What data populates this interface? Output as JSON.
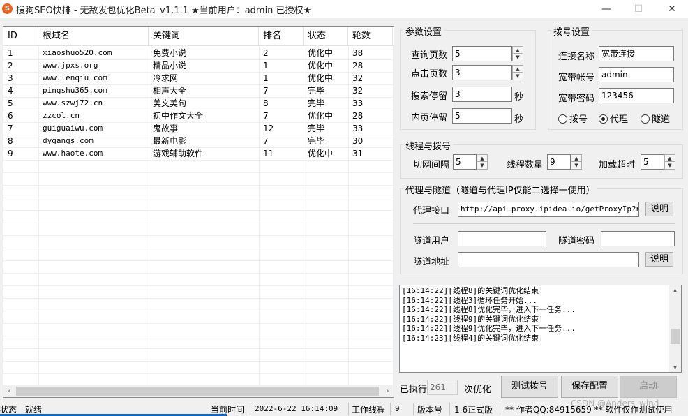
{
  "window": {
    "title": "搜狗SEO快排 - 无敌发包优化Beta_v1.1.1  ★当前用户：admin 已授权★",
    "minimize_glyph": "—",
    "maximize_glyph": "☐",
    "close_glyph": "✕"
  },
  "table": {
    "columns": [
      "ID",
      "根域名",
      "关键词",
      "排名",
      "状态",
      "轮数"
    ],
    "rows": [
      {
        "id": "1",
        "domain": "xiaoshuo520.com",
        "keyword": "免费小说",
        "rank": "2",
        "status": "优化中",
        "rounds": "38"
      },
      {
        "id": "2",
        "domain": "www.jpxs.org",
        "keyword": "精品小说",
        "rank": "1",
        "status": "优化中",
        "rounds": "28"
      },
      {
        "id": "3",
        "domain": "www.lenqiu.com",
        "keyword": "冷求网",
        "rank": "1",
        "status": "优化中",
        "rounds": "32"
      },
      {
        "id": "4",
        "domain": "pingshu365.com",
        "keyword": "相声大全",
        "rank": "7",
        "status": "完毕",
        "rounds": "32"
      },
      {
        "id": "5",
        "domain": "www.szwj72.cn",
        "keyword": "美文美句",
        "rank": "8",
        "status": "完毕",
        "rounds": "33"
      },
      {
        "id": "6",
        "domain": "zzcol.cn",
        "keyword": "初中作文大全",
        "rank": "7",
        "status": "优化中",
        "rounds": "28"
      },
      {
        "id": "7",
        "domain": "guiguaiwu.com",
        "keyword": "鬼故事",
        "rank": "12",
        "status": "完毕",
        "rounds": "33"
      },
      {
        "id": "8",
        "domain": "dygangs.com",
        "keyword": "最新电影",
        "rank": "7",
        "status": "完毕",
        "rounds": "30"
      },
      {
        "id": "9",
        "domain": "www.haote.com",
        "keyword": "游戏辅助软件",
        "rank": "11",
        "status": "优化中",
        "rounds": "31"
      }
    ],
    "scroll_left": "‹",
    "scroll_right": "›"
  },
  "params": {
    "title": "参数设置",
    "query_pages_label": "查询页数",
    "query_pages": "5",
    "click_pages_label": "点击页数",
    "click_pages": "3",
    "search_stay_label": "搜索停留",
    "search_stay": "3",
    "search_stay_unit": "秒",
    "inner_stay_label": "内页停留",
    "inner_stay": "5",
    "inner_stay_unit": "秒"
  },
  "dial": {
    "title": "拨号设置",
    "conn_name_label": "连接名称",
    "conn_name": "宽带连接",
    "account_label": "宽带帐号",
    "account": "admin",
    "password_label": "宽带密码",
    "password": "123456",
    "radio_dial": "拨号",
    "radio_proxy": "代理",
    "radio_tunnel": "隧道",
    "selected": "代理"
  },
  "threads": {
    "title": "线程与拨号",
    "switch_label": "切网间隔",
    "switch": "5",
    "count_label": "线程数量",
    "count": "9",
    "timeout_label": "加载超时",
    "timeout": "5"
  },
  "proxy": {
    "title": "代理与隧道（隧道与代理IP仅能二选择一使用）",
    "api_label": "代理接口",
    "api": "http://api.proxy.ipidea.io/getProxyIp?num",
    "explain1": "说明",
    "tunnel_user_label": "隧道用户",
    "tunnel_user": "",
    "tunnel_pass_label": "隧道密码",
    "tunnel_pass": "",
    "tunnel_addr_label": "隧道地址",
    "tunnel_addr": "",
    "explain2": "说明"
  },
  "log": [
    "[16:14:22][线程8]的关键词优化结束!",
    "[16:14:22][线程3]循环任务开始...",
    "[16:14:22][线程8]优化完毕，进入下一任务...",
    "[16:14:22][线程9]的关键词优化结束!",
    "[16:14:22][线程9]优化完毕，进入下一任务...",
    "[16:14:23][线程4]的关键词优化结束!"
  ],
  "actions": {
    "executed_label": "已执行",
    "executed": "261",
    "executed_unit": "次优化",
    "test_dial": "测试拨号",
    "save_config": "保存配置",
    "start": "启动"
  },
  "status": {
    "status_label": "状态",
    "status": "就绪",
    "time_label": "当前时间",
    "time": "2022-6-22 16:14:09",
    "threads_label": "工作线程",
    "threads": "9",
    "version_label": "版本号",
    "version": "1.6正式版",
    "author": "** 作者QQ:84915659 ** 软件仅作测试使用",
    "watermark": "CSDN @Anders_wind"
  }
}
